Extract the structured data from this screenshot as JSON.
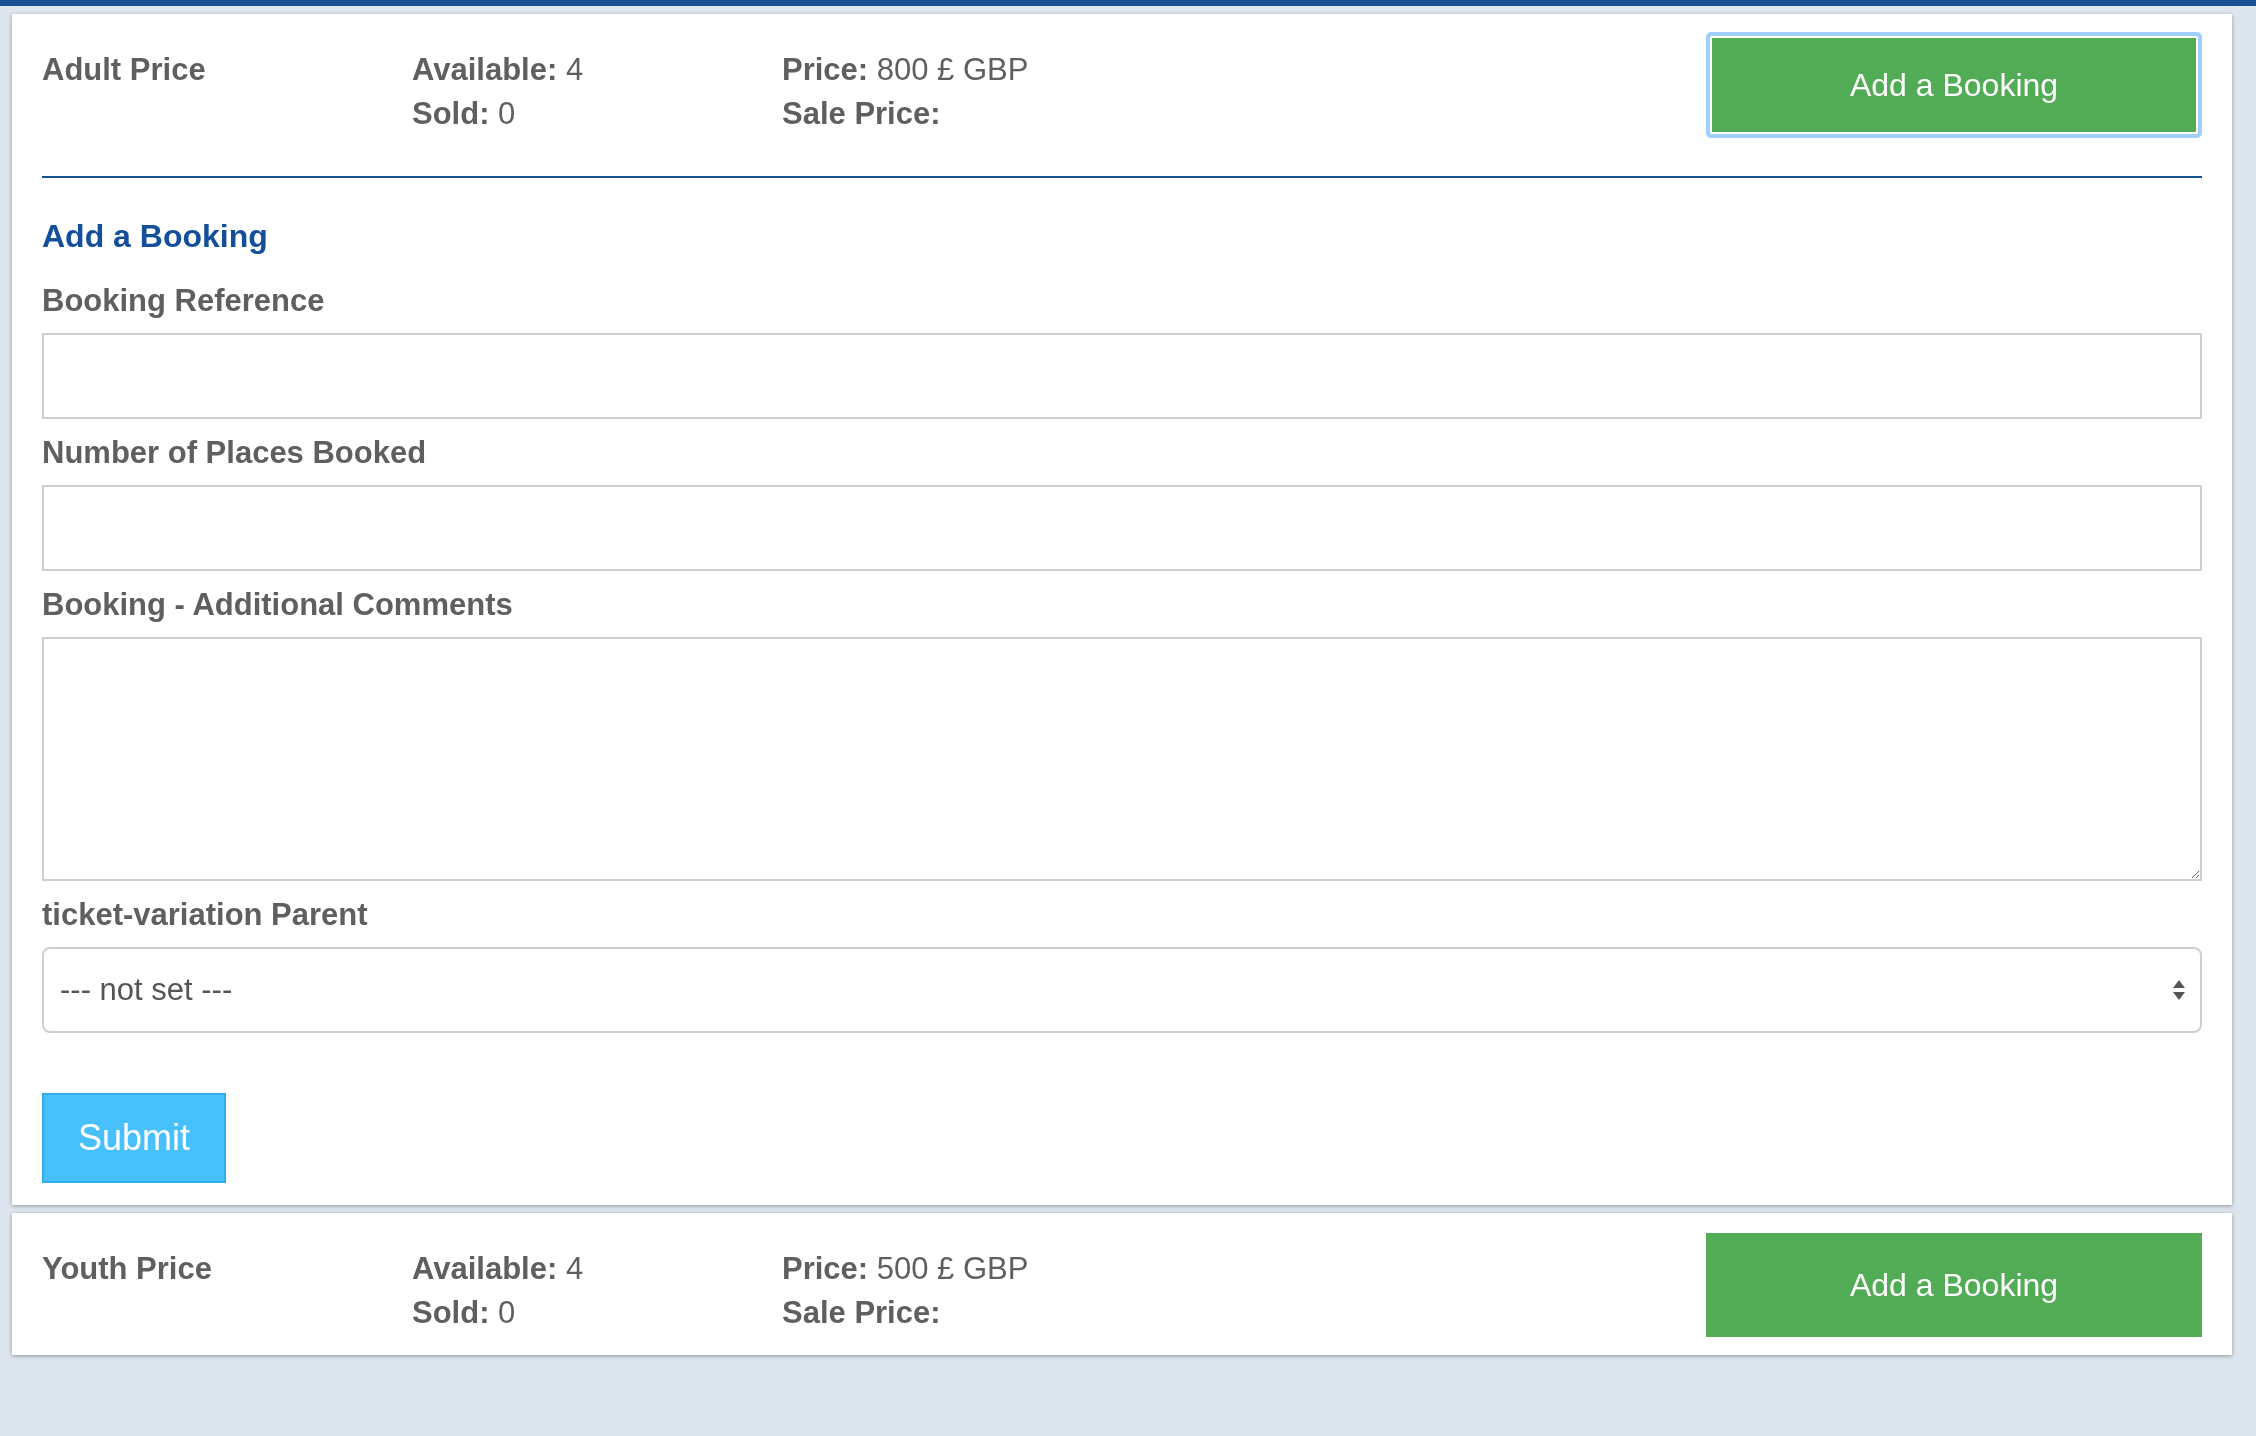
{
  "tickets": [
    {
      "name": "Adult Price",
      "available": "**Available:** 4",
      "sold": "**Sold:** 0",
      "price": "**Price:** 800 £ GBP",
      "sale_price": "**Sale Price:**",
      "button": {
        "label": "Add a Booking",
        "focused": true
      },
      "form": {
        "title": "Add a Booking",
        "fields": [
          {
            "kind": "input",
            "label": "Booking Reference"
          },
          {
            "kind": "input",
            "label": "Number of Places Booked"
          },
          {
            "kind": "textarea",
            "label": "Booking - Additional Comments"
          },
          {
            "kind": "select",
            "label": "ticket-variation Parent",
            "value": "--- not set ---"
          }
        ],
        "submit": "Submit"
      }
    },
    {
      "name": "Youth Price",
      "available": "**Available:** 4",
      "sold": "**Sold:** 0",
      "price": "**Price:** 500 £ GBP",
      "sale_price": "**Sale Price:**",
      "button": {
        "label": "Add a Booking",
        "focused": false
      }
    }
  ]
}
